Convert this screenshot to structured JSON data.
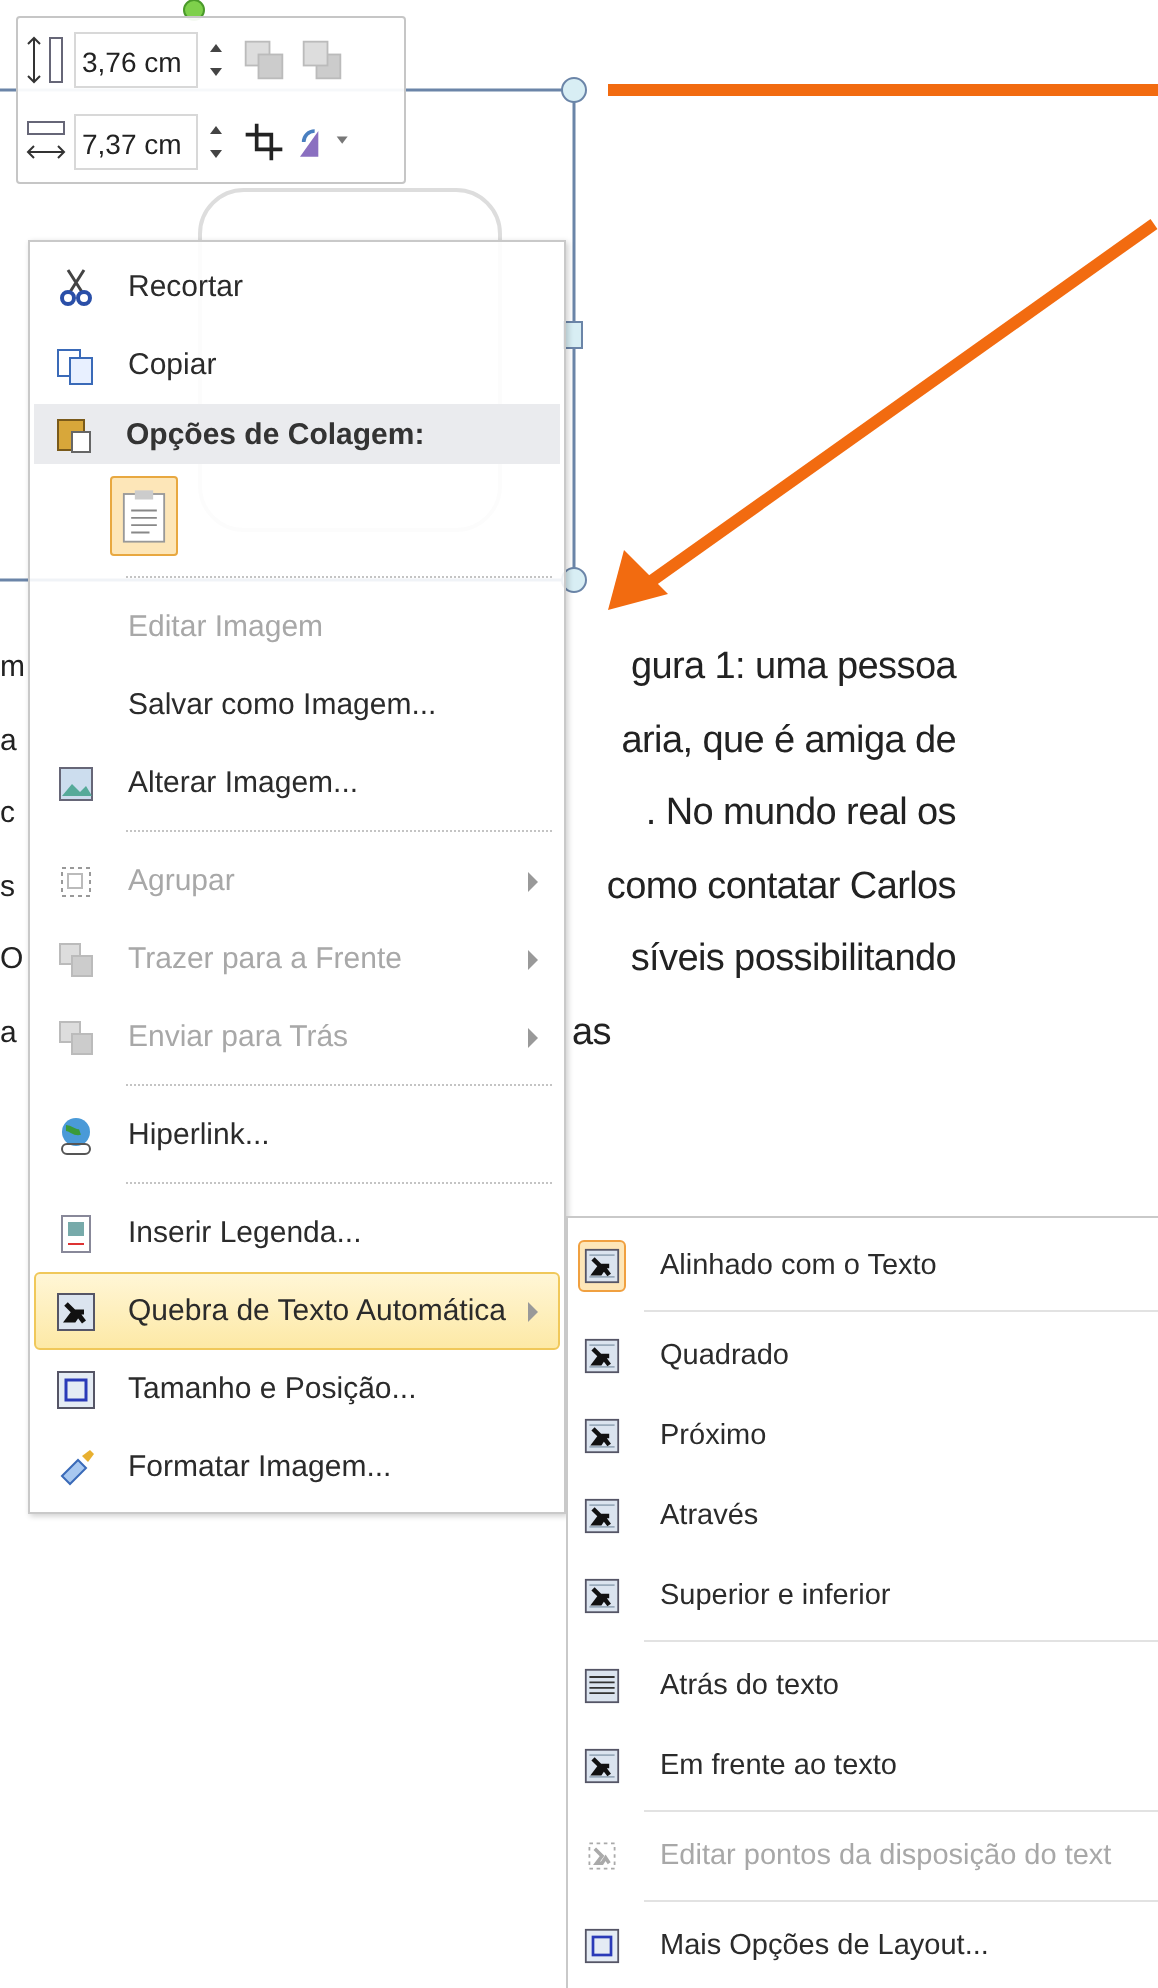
{
  "toolbar": {
    "height_field": {
      "value": "3,76 cm"
    },
    "width_field": {
      "value": "7,37 cm"
    }
  },
  "document": {
    "left_fragments": [
      "m",
      "a",
      "c",
      "s",
      "O",
      "a"
    ],
    "lines": [
      "gura 1: uma pessoa",
      "aria, que é amiga de",
      ". No mundo real os",
      "como contatar Carlos",
      "síveis possibilitando",
      "as"
    ]
  },
  "context_menu": {
    "items": [
      {
        "kind": "item",
        "label": "Recortar",
        "disabled": false,
        "submenu": false,
        "selected": false
      },
      {
        "kind": "item",
        "label": "Copiar",
        "disabled": false,
        "submenu": false,
        "selected": false
      },
      {
        "kind": "header",
        "label": "Opções de Colagem:"
      },
      {
        "kind": "paste"
      },
      {
        "kind": "separator"
      },
      {
        "kind": "item",
        "label": "Editar Imagem",
        "disabled": true,
        "submenu": false,
        "selected": false
      },
      {
        "kind": "item",
        "label": "Salvar como Imagem...",
        "disabled": false,
        "submenu": false,
        "selected": false
      },
      {
        "kind": "item",
        "label": "Alterar Imagem...",
        "disabled": false,
        "submenu": false,
        "selected": false
      },
      {
        "kind": "separator"
      },
      {
        "kind": "item",
        "label": "Agrupar",
        "disabled": true,
        "submenu": true,
        "selected": false
      },
      {
        "kind": "item",
        "label": "Trazer para a Frente",
        "disabled": true,
        "submenu": true,
        "selected": false
      },
      {
        "kind": "item",
        "label": "Enviar para Trás",
        "disabled": true,
        "submenu": true,
        "selected": false
      },
      {
        "kind": "separator"
      },
      {
        "kind": "item",
        "label": "Hiperlink...",
        "disabled": false,
        "submenu": false,
        "selected": false
      },
      {
        "kind": "separator"
      },
      {
        "kind": "item",
        "label": "Inserir Legenda...",
        "disabled": false,
        "submenu": false,
        "selected": false
      },
      {
        "kind": "item",
        "label": "Quebra de Texto Automática",
        "disabled": false,
        "submenu": true,
        "selected": true
      },
      {
        "kind": "item",
        "label": "Tamanho e Posição...",
        "disabled": false,
        "submenu": false,
        "selected": false
      },
      {
        "kind": "item",
        "label": "Formatar Imagem...",
        "disabled": false,
        "submenu": false,
        "selected": false
      }
    ]
  },
  "wrap_submenu": {
    "items": [
      {
        "kind": "item",
        "label": "Alinhado com o Texto",
        "checked": true,
        "disabled": false
      },
      {
        "kind": "separator"
      },
      {
        "kind": "item",
        "label": "Quadrado",
        "checked": false,
        "disabled": false
      },
      {
        "kind": "item",
        "label": "Próximo",
        "checked": false,
        "disabled": false
      },
      {
        "kind": "item",
        "label": "Através",
        "checked": false,
        "disabled": false
      },
      {
        "kind": "item",
        "label": "Superior e inferior",
        "checked": false,
        "disabled": false
      },
      {
        "kind": "separator"
      },
      {
        "kind": "item",
        "label": "Atrás do texto",
        "checked": false,
        "disabled": false
      },
      {
        "kind": "item",
        "label": "Em frente ao texto",
        "checked": false,
        "disabled": false
      },
      {
        "kind": "separator"
      },
      {
        "kind": "item",
        "label": "Editar pontos da disposição do text",
        "checked": false,
        "disabled": true
      },
      {
        "kind": "separator"
      },
      {
        "kind": "item",
        "label": "Mais Opções de Layout...",
        "checked": false,
        "disabled": false
      }
    ]
  }
}
